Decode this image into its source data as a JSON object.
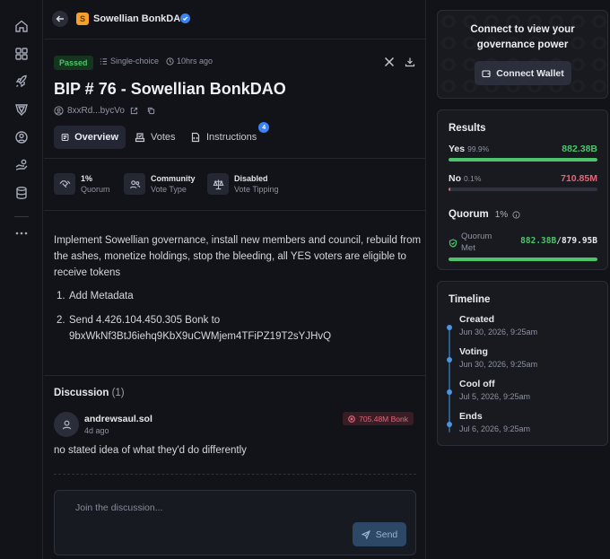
{
  "dao": {
    "name": "Sowellian BonkDAO",
    "avatar_letter": "S"
  },
  "proposal": {
    "status": "Passed",
    "choice_type": "Single-choice",
    "age": "10hrs ago",
    "title": "BIP # 76 - Sowellian BonkDAO",
    "author": "8xxRd...bycVo"
  },
  "tabs": [
    {
      "label": "Overview"
    },
    {
      "label": "Votes"
    },
    {
      "label": "Instructions",
      "count": "4"
    }
  ],
  "stats": [
    {
      "value": "1%",
      "label": "Quorum"
    },
    {
      "value": "Community",
      "label": "Vote Type"
    },
    {
      "value": "Disabled",
      "label": "Vote Tipping"
    }
  ],
  "description": "Implement Sowellian governance, install new members and council, rebuild from the ashes, monetize holdings, stop the bleeding, all YES voters are eligible to receive tokens",
  "instructions_list": [
    {
      "num": "1.",
      "line1": "Add Metadata",
      "line2": ""
    },
    {
      "num": "2.",
      "line1": "Send 4.426.104.450.305 Bonk to",
      "line2": "9bxWkNf3BtJ6iehq9KbX9uCWMjem4TFiPZ19T2sYJHvQ"
    }
  ],
  "discussion": {
    "title": "Discussion",
    "count": "(1)",
    "comment": {
      "user": "andrewsaul.sol",
      "time": "4d ago",
      "badge": "705.48M Bonk",
      "text": "no stated idea of what they'd do differently"
    },
    "placeholder": "Join the discussion...",
    "send_label": "Send"
  },
  "connect": {
    "line1": "Connect to view your",
    "line2": "governance power",
    "button": "Connect Wallet"
  },
  "results": {
    "title": "Results",
    "yes": {
      "label": "Yes",
      "pct": "99.9%",
      "amount": "882.38B",
      "fraction": 0.999,
      "color": "#4cc46a"
    },
    "no": {
      "label": "No",
      "pct": "0.1%",
      "amount": "710.85M",
      "fraction": 0.001,
      "color": "#e0667a"
    },
    "quorum_title": "Quorum",
    "quorum_pct": "1%",
    "quorum_met_label": "Quorum Met",
    "quorum_have": "882.38B",
    "quorum_sep": "/",
    "quorum_need": "879.95B",
    "quorum_fraction": 1.0
  },
  "timeline": {
    "title": "Timeline",
    "items": [
      {
        "name": "Created",
        "date": "Jun 30, 2026, 9:25am"
      },
      {
        "name": "Voting",
        "date": "Jun 30, 2026, 9:25am"
      },
      {
        "name": "Cool off",
        "date": "Jul 5, 2026, 9:25am"
      },
      {
        "name": "Ends",
        "date": "Jul 6, 2026, 9:25am"
      }
    ]
  }
}
